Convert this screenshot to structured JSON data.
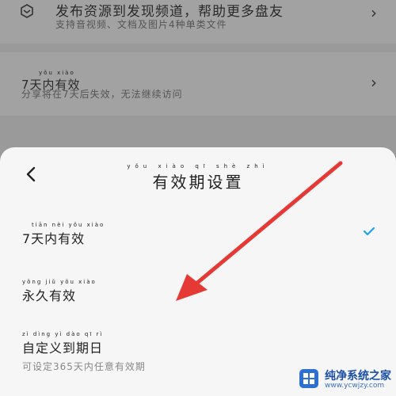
{
  "background": {
    "publish_title": "发布资源到发现频道，帮助更多盘友",
    "publish_sub": "支持音视频、文档及图片4种单类文件",
    "validity_pinyin": "yǒu xiào",
    "validity_title": "7天内有效",
    "validity_sub": "分享将在7天后失效，无法继续访问"
  },
  "sheet": {
    "title": "有效期设置",
    "title_pinyin": "yǒu xiào qī shè zhì",
    "options": [
      {
        "label": "7天内有效",
        "pinyin": "tiān nèi yǒu xiào",
        "sub": "",
        "selected": true
      },
      {
        "label": "永久有效",
        "pinyin": "yǒng jiǔ yǒu xiào",
        "sub": "",
        "selected": false
      },
      {
        "label": "自定义到期日",
        "pinyin": "zì dìng yì dào qī rì",
        "sub": "可设定365天内任意有效期",
        "selected": false
      }
    ]
  },
  "watermark": {
    "text": "纯净系统之家",
    "url": "www.ycwjzy.com"
  },
  "colors": {
    "accent": "#1aa3e8",
    "arrow": "#e53935"
  }
}
